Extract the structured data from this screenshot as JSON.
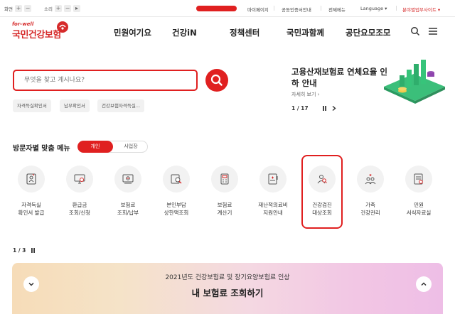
{
  "topbar": {
    "screen_label": "화면",
    "sound_label": "소리",
    "links": [
      "마이페이지",
      "공동인증서안내",
      "전체메뉴"
    ],
    "language": "Language",
    "branch_sites": "분야별업무사이트"
  },
  "logo": {
    "tagline": "for-well",
    "name": "국민건강보험"
  },
  "nav": [
    "민원여기요",
    "건강iN",
    "정책센터",
    "국민과함께",
    "공단요모조모"
  ],
  "search": {
    "placeholder": "무엇을 찾고 계시나요?",
    "chips": [
      "자격득실확인서",
      "납부확인서",
      "건강보험자격득실..."
    ]
  },
  "banner": {
    "title": "고용산재보험료 연체요율 인하 안내",
    "more": "자세히 보기",
    "pager": "1 / 17"
  },
  "menu_section": {
    "title": "방문자별 맞춤 메뉴",
    "tab_active": "개인",
    "tab_inactive": "사업장",
    "items": [
      {
        "label": "자격득실\n확인서 발급",
        "icon": "id-card-icon"
      },
      {
        "label": "환급금\n조회/신청",
        "icon": "monitor-refund-icon"
      },
      {
        "label": "보험료\n조회/납부",
        "icon": "receipt-icon"
      },
      {
        "label": "본인부담\n상한액조회",
        "icon": "magnifier-doc-icon"
      },
      {
        "label": "보험료\n계산기",
        "icon": "calculator-icon"
      },
      {
        "label": "재난적의료비\n지원안내",
        "icon": "medical-fund-icon"
      },
      {
        "label": "건강검진\n대상조회",
        "icon": "people-search-icon"
      },
      {
        "label": "가족\n건강관리",
        "icon": "family-heart-icon"
      },
      {
        "label": "민원\n서식자료실",
        "icon": "form-doc-icon"
      }
    ],
    "pager": "1 / 3"
  },
  "bottom_banner": {
    "subtitle": "2021년도 건강보험료 및 장기요양보험료 인상",
    "title": "내 보험료 조회하기"
  },
  "colors": {
    "accent": "#e02020",
    "brand": "#d62b2b"
  }
}
